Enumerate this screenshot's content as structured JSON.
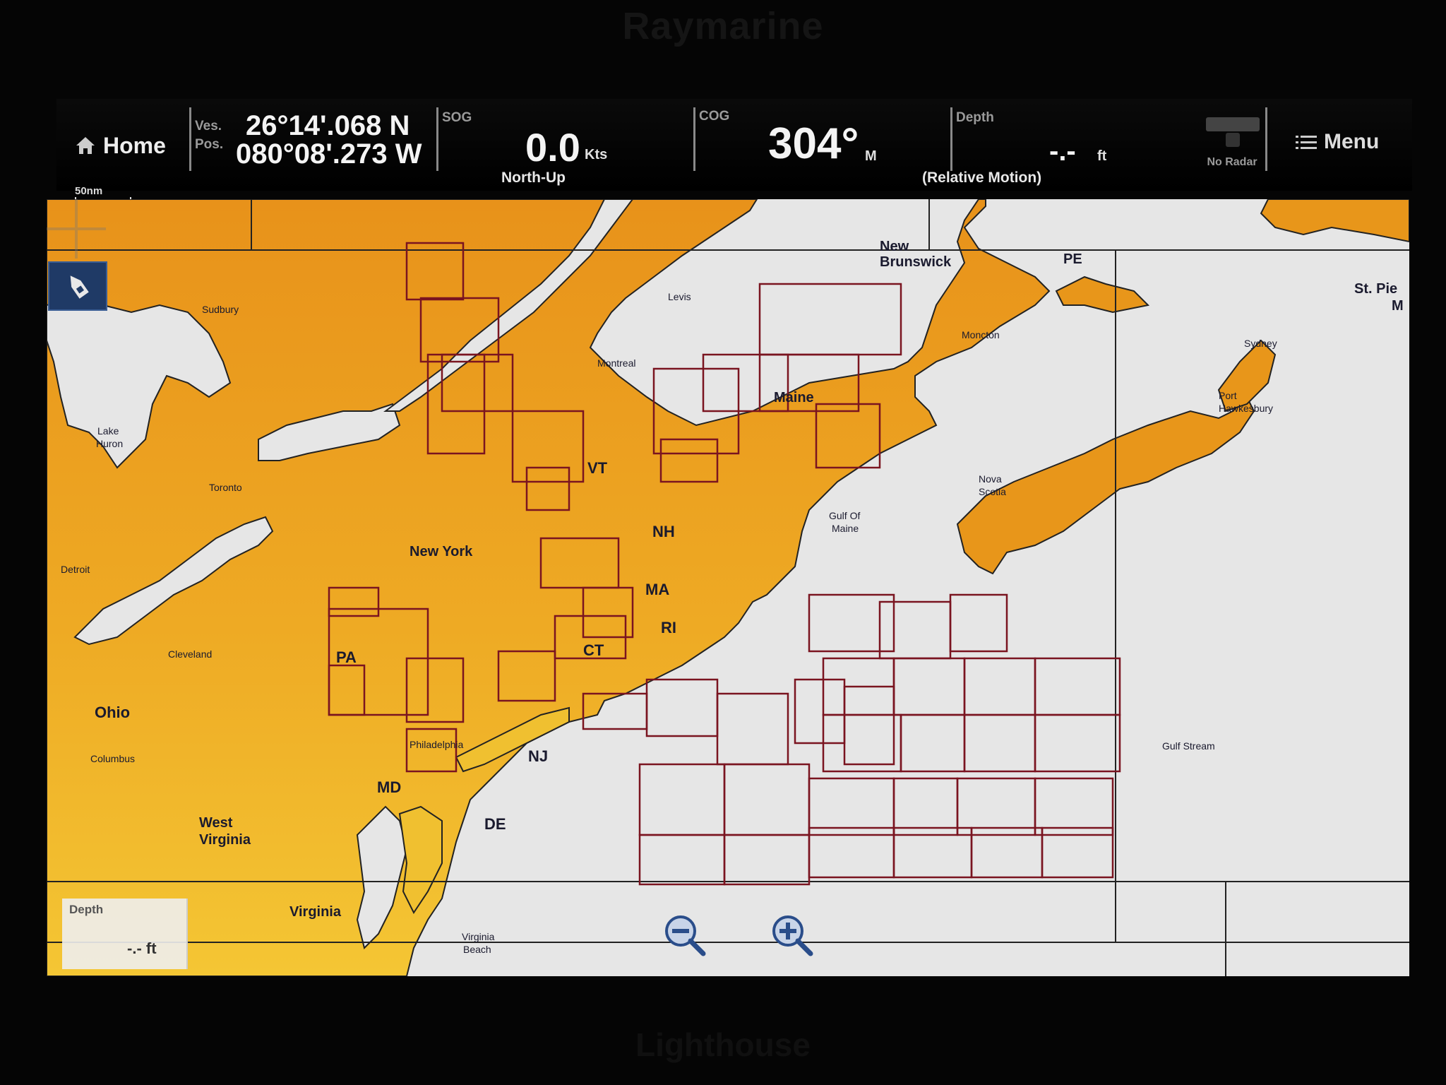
{
  "bezel": {
    "brand": "Raymarine",
    "footer": "Lighthouse"
  },
  "topbar": {
    "home_label": "Home",
    "position": {
      "label_top": "Ves.",
      "label_bottom": "Pos.",
      "lat": "26°14'.068 N",
      "lon": "080°08'.273 W"
    },
    "sog": {
      "label": "SOG",
      "value": "0.0",
      "unit": "Kts",
      "footer": "North-Up"
    },
    "cog": {
      "label": "COG",
      "value": "304°",
      "unit": "M"
    },
    "depth": {
      "label": "Depth",
      "value": "-.-",
      "unit": "ft",
      "footer": "(Relative Motion)"
    },
    "radar_status": "No Radar",
    "menu_label": "Menu"
  },
  "chart": {
    "scale": "50nm",
    "land_color": "#e8961a",
    "land_color_light": "#f4c230",
    "water_color": "#e8e8e8",
    "grid_color": "#7a1420",
    "labels": {
      "new_brunswick_1": "New",
      "new_brunswick_2": "Brunswick",
      "pe": "PE",
      "st_pierre_1": "St. Pie",
      "st_pierre_2": "M",
      "sudbury": "Sudbury",
      "levis": "Levis",
      "moncton": "Moncton",
      "sydney": "Sydney",
      "montreal": "Montreal",
      "port_hawkesbury_1": "Port",
      "port_hawkesbury_2": "Hawkesbury",
      "maine": "Maine",
      "lake_huron_1": "Lake",
      "lake_huron_2": "Huron",
      "toronto": "Toronto",
      "vt": "VT",
      "nova_scotia_1": "Nova",
      "nova_scotia_2": "Scotia",
      "gulf_of_maine_1": "Gulf Of",
      "gulf_of_maine_2": "Maine",
      "nh": "NH",
      "new_york": "New York",
      "detroit": "Detroit",
      "ma": "MA",
      "ri": "RI",
      "cleveland": "Cleveland",
      "pa": "PA",
      "ct": "CT",
      "ohio": "Ohio",
      "philadelphia": "Philadelphia",
      "gulf_stream": "Gulf Stream",
      "columbus": "Columbus",
      "nj": "NJ",
      "md": "MD",
      "de": "DE",
      "west_virginia_1": "West",
      "west_virginia_2": "Virginia",
      "virginia": "Virginia",
      "virginia_beach_1": "Virginia",
      "virginia_beach_2": "Beach"
    },
    "depth_box": {
      "label": "Depth",
      "value": "-.- ft"
    },
    "icons": [
      "boat-icon",
      "zoom-out-icon",
      "zoom-in-icon",
      "crosshair-icon",
      "home-icon",
      "menu-icon",
      "radar-icon"
    ]
  }
}
